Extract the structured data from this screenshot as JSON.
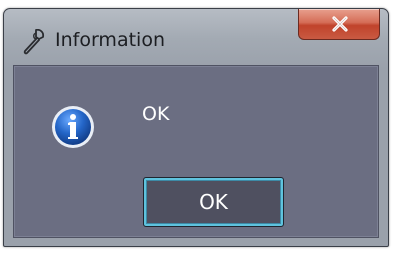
{
  "window": {
    "title": "Information",
    "title_icon": "wrench-icon",
    "close_icon": "close-icon"
  },
  "dialog": {
    "icon": "info-icon",
    "message": "OK",
    "ok_button_label": "OK"
  },
  "colors": {
    "client_background": "#6b6e82",
    "close_button": "#c95a42",
    "focus_ring": "#5fc3de",
    "info_icon": "#1f5fbf"
  }
}
